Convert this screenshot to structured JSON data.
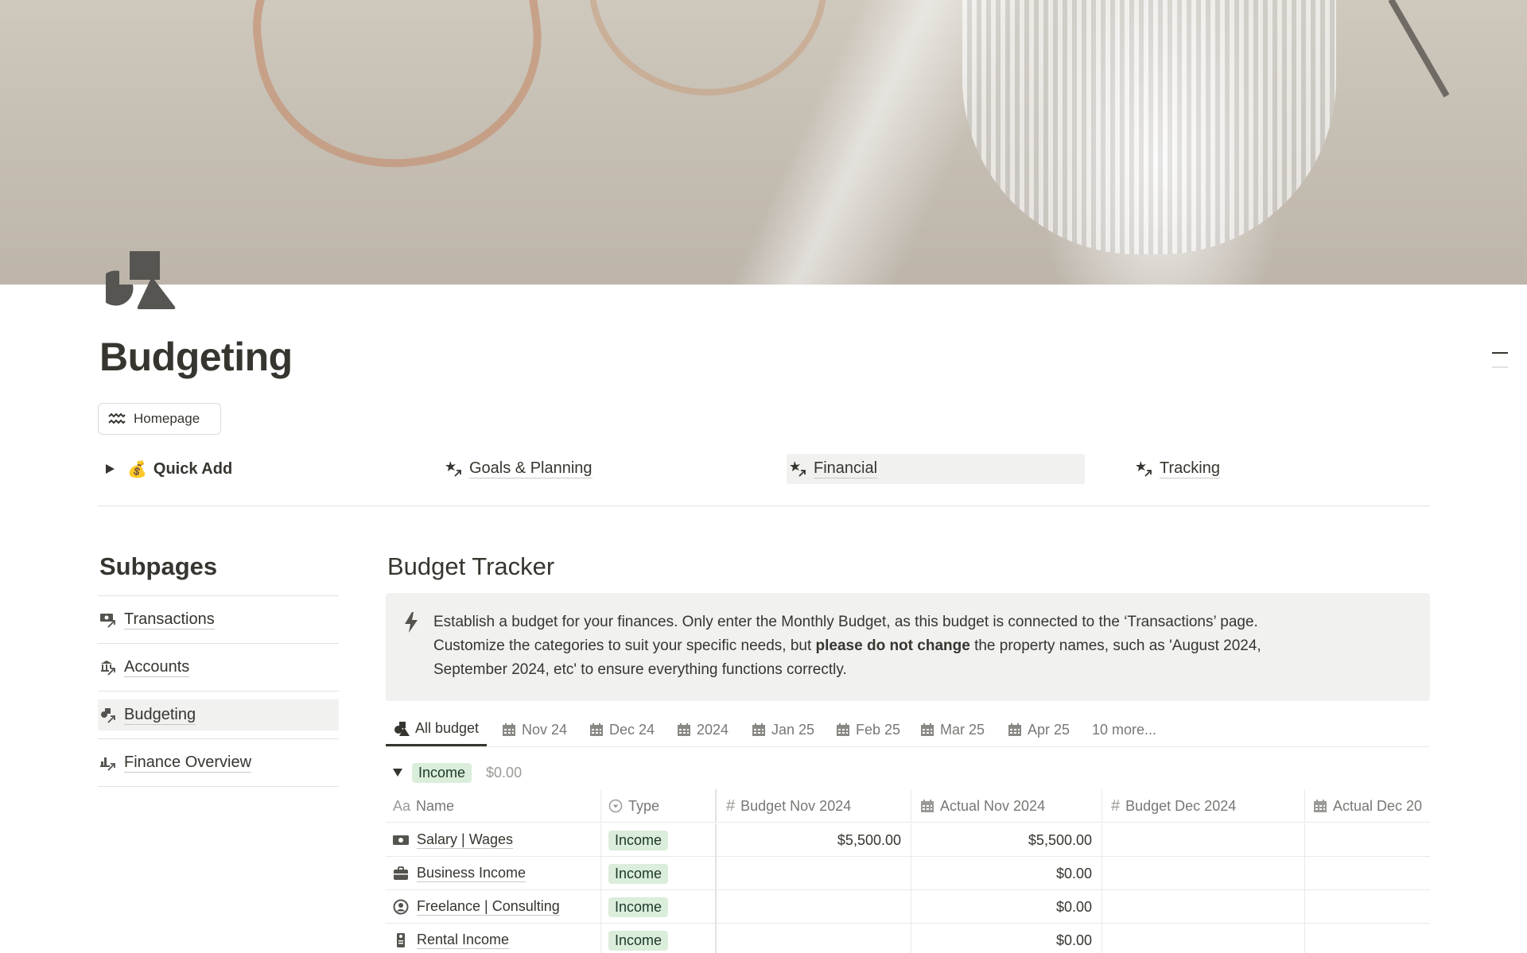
{
  "page": {
    "title": "Budgeting",
    "icon": "shapes-icon",
    "homepage_button": "Homepage"
  },
  "nav": {
    "quick_add": {
      "emoji": "💰",
      "label": "Quick Add"
    },
    "links": [
      {
        "label": "Goals & Planning",
        "icon": "linked-page-icon"
      },
      {
        "label": "Financial",
        "icon": "linked-page-icon",
        "active": true
      },
      {
        "label": "Tracking",
        "icon": "linked-page-icon"
      }
    ]
  },
  "subpages": {
    "title": "Subpages",
    "items": [
      {
        "label": "Transactions",
        "icon": "money-link-icon"
      },
      {
        "label": "Accounts",
        "icon": "bank-link-icon"
      },
      {
        "label": "Budgeting",
        "icon": "shapes-link-icon",
        "active": true
      },
      {
        "label": "Finance Overview",
        "icon": "chart-link-icon"
      }
    ]
  },
  "budget_tracker": {
    "title": "Budget Tracker",
    "callout": {
      "line1": "Establish a budget for your finances. Only enter the Monthly Budget, as this budget is connected to the ‘Transactions’ page.",
      "line2_pre": "Customize the categories to suit your specific needs, but ",
      "line2_bold": "please do not change",
      "line2_post": " the property names, such as 'August 2024,",
      "line3": "September 2024, etc' to ensure everything functions correctly."
    },
    "tabs": [
      {
        "label": "All budget",
        "active": true
      },
      {
        "label": "Nov 24"
      },
      {
        "label": "Dec 24"
      },
      {
        "label": "2024"
      },
      {
        "label": "Jan 25"
      },
      {
        "label": "Feb 25"
      },
      {
        "label": "Mar 25"
      },
      {
        "label": "Apr 25"
      }
    ],
    "more_tabs": "10 more...",
    "group": {
      "tag": "Income",
      "sum": "$0.00"
    },
    "columns": {
      "name": {
        "prefix": "Aa",
        "label": "Name"
      },
      "type": "Type",
      "budget_nov": "Budget Nov 2024",
      "actual_nov": "Actual Nov 2024",
      "budget_dec": "Budget Dec 2024",
      "actual_dec": "Actual Dec 20"
    },
    "rows": [
      {
        "name": "Salary | Wages",
        "icon": "cash-icon",
        "type": "Income",
        "budget_nov": "$5,500.00",
        "actual_nov": "$5,500.00",
        "budget_dec": "",
        "actual_dec": ""
      },
      {
        "name": "Business Income",
        "icon": "briefcase-icon",
        "type": "Income",
        "budget_nov": "",
        "actual_nov": "$0.00",
        "budget_dec": "",
        "actual_dec": ""
      },
      {
        "name": "Freelance | Consulting",
        "icon": "user-circle-icon",
        "type": "Income",
        "budget_nov": "",
        "actual_nov": "$0.00",
        "budget_dec": "",
        "actual_dec": ""
      },
      {
        "name": "Rental Income",
        "icon": "door-hanger-icon",
        "type": "Income",
        "budget_nov": "",
        "actual_nov": "$0.00",
        "budget_dec": "",
        "actual_dec": ""
      }
    ]
  },
  "colors": {
    "text": "#37352f",
    "muted": "#787774",
    "income_tag_bg": "#dbeddb",
    "income_tag_text": "#1c3829",
    "callout_bg": "#f1f1ef"
  }
}
